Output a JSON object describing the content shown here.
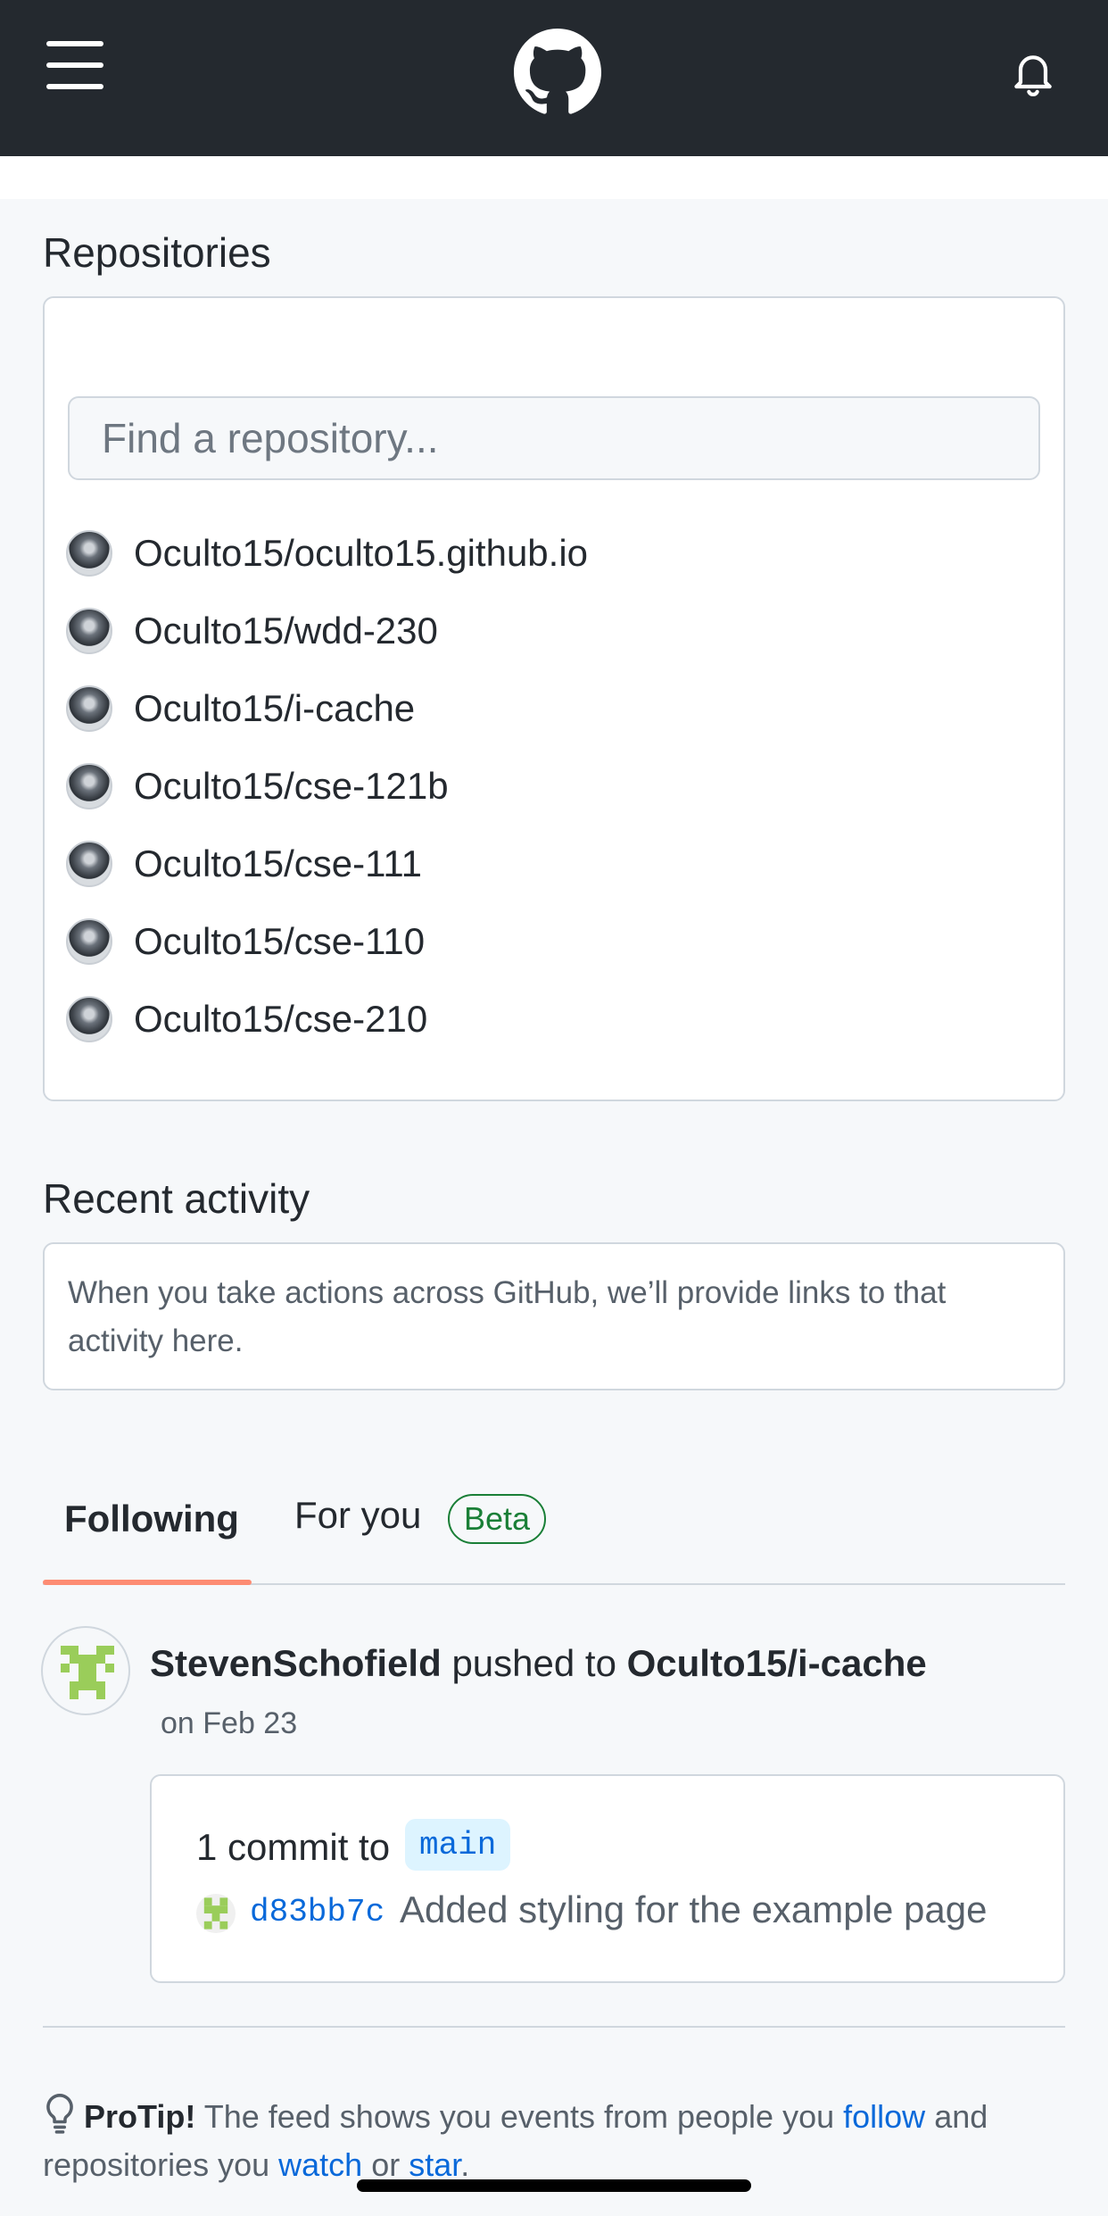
{
  "header": {
    "menu_icon": "hamburger-icon",
    "logo_icon": "github-octocat-icon",
    "notifications_icon": "bell-icon"
  },
  "repositories": {
    "title": "Repositories",
    "search_placeholder": "Find a repository...",
    "items": [
      {
        "name": "Oculto15/oculto15.github.io"
      },
      {
        "name": "Oculto15/wdd-230"
      },
      {
        "name": "Oculto15/i-cache"
      },
      {
        "name": "Oculto15/cse-121b"
      },
      {
        "name": "Oculto15/cse-111"
      },
      {
        "name": "Oculto15/cse-110"
      },
      {
        "name": "Oculto15/cse-210"
      }
    ]
  },
  "recent_activity": {
    "title": "Recent activity",
    "message_line1": "When you take actions across GitHub, we’ll provide links to that",
    "message_line2": "activity here."
  },
  "feed_tabs": {
    "following": "Following",
    "for_you": "For you",
    "beta": "Beta"
  },
  "feed_item": {
    "actor": "StevenSchofield",
    "action": "pushed to",
    "repo": "Oculto15/i-cache",
    "date": "on Feb 23",
    "commit_count": "1 commit to",
    "branch": "main",
    "sha": "d83bb7c",
    "message": "Added styling for the example page"
  },
  "protip": {
    "label": "ProTip!",
    "text1": "The feed shows you events from people you",
    "follow": "follow",
    "text2": "and",
    "text3": "repositories you",
    "watch": "watch",
    "or": "or",
    "star": "star",
    "period": "."
  },
  "colors": {
    "header_bg": "#24292f",
    "link": "#0969da",
    "tab_underline": "#fd8c73",
    "beta_green": "#1a7f37",
    "identicon_green": "#9acd5a"
  }
}
